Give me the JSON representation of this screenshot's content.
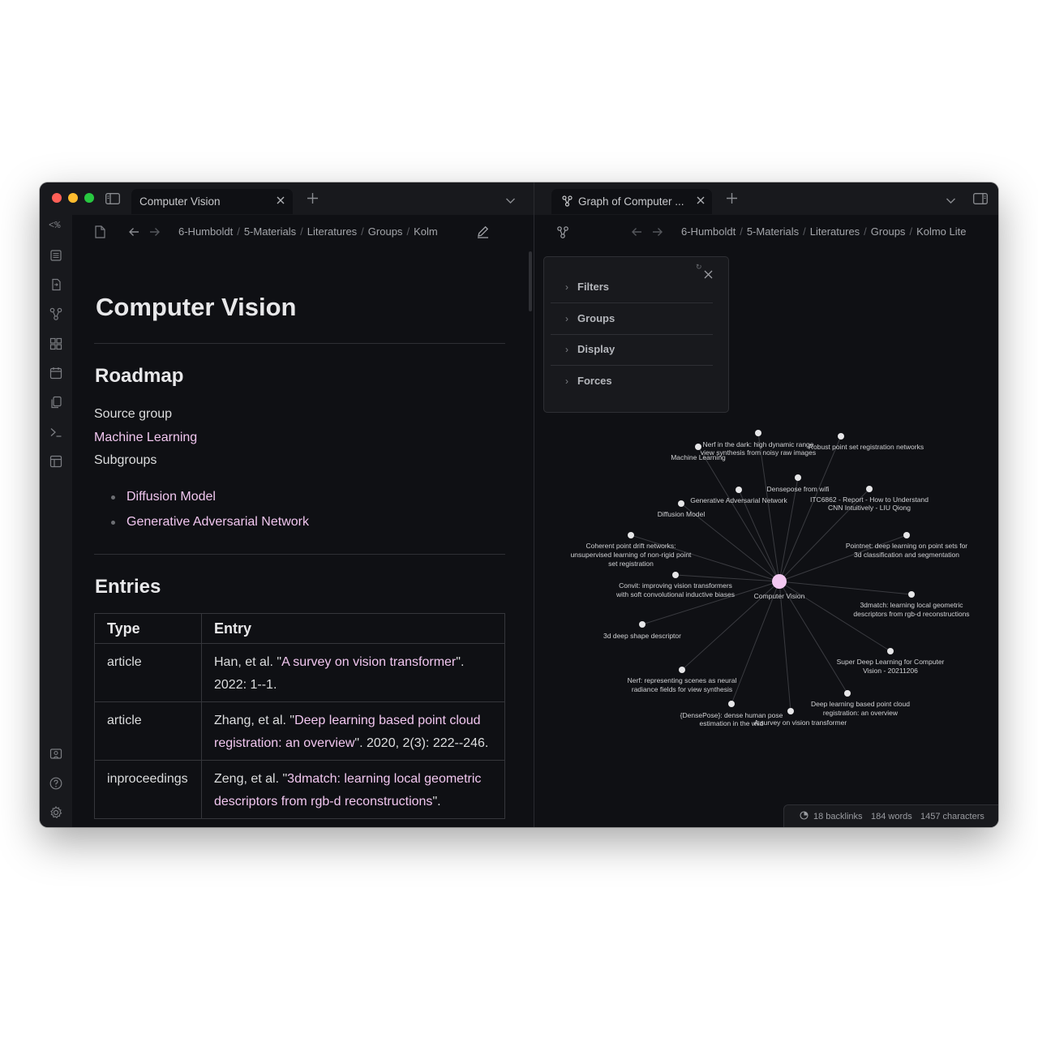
{
  "window": {
    "traffic_lights": [
      "#ff5f57",
      "#febc2e",
      "#28c840"
    ]
  },
  "left_tab": {
    "title": "Computer Vision"
  },
  "right_tab": {
    "title": "Graph of Computer ..."
  },
  "ribbon": {
    "top_label": "<%"
  },
  "left_breadcrumb": [
    "6-Humboldt",
    "5-Materials",
    "Literatures",
    "Groups",
    "Kolm"
  ],
  "right_breadcrumb": [
    "6-Humboldt",
    "5-Materials",
    "Literatures",
    "Groups",
    "Kolmo Lite"
  ],
  "document": {
    "title": "Computer Vision",
    "roadmap_heading": "Roadmap",
    "source_group_label": "Source group",
    "source_group_link": "Machine Learning",
    "subgroups_label": "Subgroups",
    "subgroups": [
      "Diffusion Model",
      "Generative Adversarial Network"
    ],
    "entries_heading": "Entries",
    "table": {
      "headers": [
        "Type",
        "Entry"
      ],
      "rows": [
        {
          "type": "article",
          "prefix": "Han, et al. \"",
          "link": "A survey on vision transformer",
          "suffix": "\". 2022: 1--1."
        },
        {
          "type": "article",
          "prefix": "Zhang, et al. \"",
          "link": "Deep learning based point cloud registration: an overview",
          "suffix": "\". 2020, 2(3): 222--246."
        },
        {
          "type": "inproceedings",
          "prefix": "Zeng, et al. \"",
          "link": "3dmatch: learning local geometric descriptors from rgb-d reconstructions",
          "suffix": "\"."
        }
      ]
    },
    "link_color": "#f1c6ef"
  },
  "graph_settings": {
    "sections": [
      "Filters",
      "Groups",
      "Display",
      "Forces"
    ]
  },
  "graph": {
    "center": "Computer Vision",
    "center_color": "#f3c8f1",
    "nodes": [
      "Machine Learning",
      "Nerf in the dark: high dynamic range view synthesis from noisy raw images",
      "Robust point set registration networks",
      "Densepose from wifi",
      "Generative Adversarial Network",
      "ITC6862 - Report - How to Understand CNN Intuitively - LIU Qiong",
      "Diffusion Model",
      "Coherent point drift networks: unsupervised learning of non-rigid point set registration",
      "Pointnet: deep learning on point sets for 3d classification and segmentation",
      "Convit: improving vision transformers with soft convolutional inductive biases",
      "3dmatch: learning local geometric descriptors from rgb-d reconstructions",
      "3d deep shape descriptor",
      "Super Deep Learning for Computer Vision - 20211206",
      "Nerf: representing scenes as neural radiance fields for view synthesis",
      "Deep learning based point cloud registration: an overview",
      "{DensePose}: dense human pose estimation in the wild",
      "A survey on vision transformer"
    ]
  },
  "status_bar": {
    "backlinks": "18 backlinks",
    "words": "184 words",
    "characters": "1457 characters"
  }
}
